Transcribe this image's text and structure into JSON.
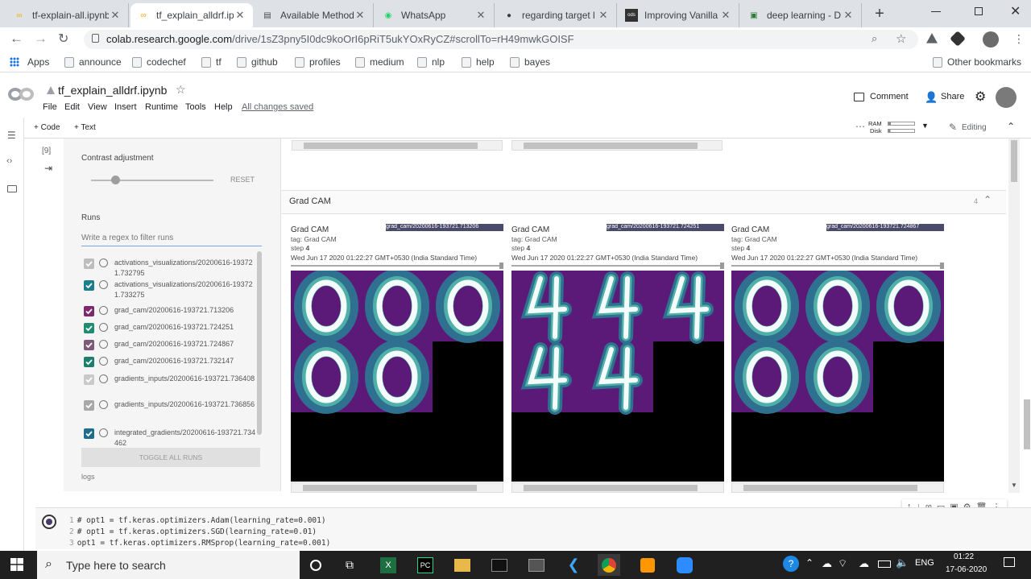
{
  "browser": {
    "tabs": [
      {
        "title": "tf-explain-all.ipynb",
        "icon": "colab-icon",
        "active": false
      },
      {
        "title": "tf_explain_alldrf.ipynb",
        "icon": "colab-icon",
        "active": true
      },
      {
        "title": "Available Methods",
        "icon": "doc-icon",
        "active": false
      },
      {
        "title": "WhatsApp",
        "icon": "whatsapp-icon",
        "active": false
      },
      {
        "title": "regarding target l",
        "icon": "github-icon",
        "active": false
      },
      {
        "title": "Improving Vanilla",
        "icon": "ods-icon",
        "active": false
      },
      {
        "title": "deep learning - D",
        "icon": "dl-icon",
        "active": false
      }
    ],
    "new_tab": "+",
    "url_host": "colab.research.google.com",
    "url_path": "/drive/1sZ3pny5I0dc9koOrI6pRiT5ukYOxRyCZ#scrollTo=rH49mwkGOISF",
    "bookmarks": [
      "Apps",
      "announce",
      "codechef",
      "tf",
      "github",
      "profiles",
      "medium",
      "nlp",
      "help",
      "bayes"
    ],
    "other_bookmarks": "Other bookmarks"
  },
  "colab": {
    "logo": "CO",
    "notebook_name": "tf_explain_alldrf.ipynb",
    "menu": [
      "File",
      "Edit",
      "View",
      "Insert",
      "Runtime",
      "Tools",
      "Help"
    ],
    "saved_status": "All changes saved",
    "comment": "Comment",
    "share": "Share",
    "add_code": "+ Code",
    "add_text": "+ Text",
    "ram_label": "RAM",
    "disk_label": "Disk",
    "editing": "Editing"
  },
  "cell": {
    "exec_count": "[9]"
  },
  "tensorboard": {
    "contrast_label": "Contrast adjustment",
    "reset": "RESET",
    "runs_label": "Runs",
    "filter_placeholder": "Write a regex to filter runs",
    "runs": [
      {
        "name": "activations_visualizations/20200616-193721.732795",
        "checked": true,
        "color": "#bdbdbd"
      },
      {
        "name": "activations_visualizations/20200616-193721.733275",
        "checked": true,
        "color": "#1e7d8c"
      },
      {
        "name": "grad_cam/20200616-193721.713206",
        "checked": true,
        "color": "#7b2a6f"
      },
      {
        "name": "grad_cam/20200616-193721.724251",
        "checked": true,
        "color": "#1e8c70"
      },
      {
        "name": "grad_cam/20200616-193721.724867",
        "checked": true,
        "color": "#7d5a7a"
      },
      {
        "name": "grad_cam/20200616-193721.732147",
        "checked": true,
        "color": "#1e7d6c"
      },
      {
        "name": "gradients_inputs/20200616-193721.736408",
        "checked": true,
        "color": "#c9c9c9"
      },
      {
        "name": "gradients_inputs/20200616-193721.736856",
        "checked": true,
        "color": "#a8a8a8"
      },
      {
        "name": "integrated_gradients/20200616-193721.734462",
        "checked": true,
        "color": "#1e6d8c"
      }
    ],
    "toggle_all": "TOGGLE ALL RUNS",
    "logs": "logs",
    "section_title": "Grad CAM",
    "section_count": "4",
    "cards": [
      {
        "title": "Grad CAM",
        "tag": "tag: Grad CAM",
        "step_label": "step",
        "step": "4",
        "date": "Wed Jun 17 2020 01:22:27 GMT+0530 (India Standard Time)",
        "run": "grad_cam/20200616-193721.713206",
        "digit": "0"
      },
      {
        "title": "Grad CAM",
        "tag": "tag: Grad CAM",
        "step_label": "step",
        "step": "4",
        "date": "Wed Jun 17 2020 01:22:27 GMT+0530 (India Standard Time)",
        "run": "grad_cam/20200616-193721.724251",
        "digit": "4"
      },
      {
        "title": "Grad CAM",
        "tag": "tag: Grad CAM",
        "step_label": "step",
        "step": "4",
        "date": "Wed Jun 17 2020 01:22:27 GMT+0530 (India Standard Time)",
        "run": "grad_cam/20200616-193721.724867",
        "digit": "0"
      }
    ]
  },
  "code_cell": {
    "lines": [
      {
        "n": "1",
        "text": "# opt1 = tf.keras.optimizers.Adam(learning_rate=0.001)"
      },
      {
        "n": "2",
        "text": "# opt1 = tf.keras.optimizers.SGD(learning_rate=0.01)"
      },
      {
        "n": "3",
        "text": "opt1 = tf.keras.optimizers.RMSprop(learning_rate=0.001)"
      }
    ]
  },
  "taskbar": {
    "search_placeholder": "Type here to search",
    "lang": "ENG",
    "time": "01:22",
    "date": "17-06-2020"
  },
  "colors": {
    "tab_strip": "#dee1e6",
    "colab_orange": "#f9ab00",
    "heatmap_purple": "#5c1a78",
    "taskbar": "#202020"
  }
}
